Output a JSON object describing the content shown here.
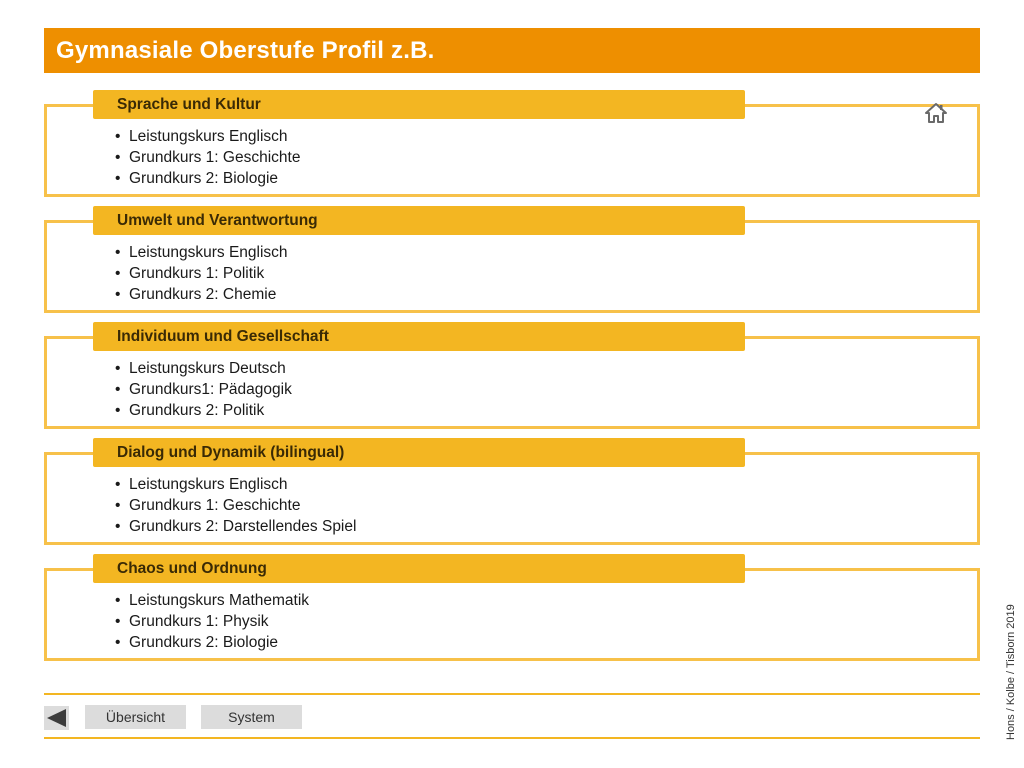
{
  "header": {
    "title": "Gymnasiale Oberstufe Profil z.B."
  },
  "profiles": [
    {
      "title": "Sprache und Kultur",
      "items": [
        "Leistungskurs Englisch",
        "Grundkurs 1: Geschichte",
        "Grundkurs 2: Biologie"
      ]
    },
    {
      "title": "Umwelt und Verantwortung",
      "items": [
        "Leistungskurs Englisch",
        "Grundkurs 1: Politik",
        "Grundkurs 2: Chemie"
      ]
    },
    {
      "title": "Individuum und Gesellschaft",
      "items": [
        "Leistungskurs Deutsch",
        "Grundkurs1: Pädagogik",
        "Grundkurs 2: Politik"
      ]
    },
    {
      "title": "Dialog und Dynamik (bilingual)",
      "items": [
        "Leistungskurs Englisch",
        "Grundkurs 1: Geschichte",
        "Grundkurs 2: Darstellendes Spiel"
      ]
    },
    {
      "title": "Chaos und Ordnung",
      "items": [
        "Leistungskurs Mathematik",
        "Grundkurs 1: Physik",
        "Grundkurs 2: Biologie"
      ]
    }
  ],
  "footer": {
    "credit": "Hons / Kolbe / Tisborn 2019",
    "overview_label": "Übersicht",
    "system_label": "System"
  },
  "icons": {
    "home": "home-icon",
    "back": "back-arrow-icon"
  },
  "colors": {
    "title_bar": "#ee8f00",
    "accent": "#f3b622",
    "box_border": "#f7c14a"
  }
}
